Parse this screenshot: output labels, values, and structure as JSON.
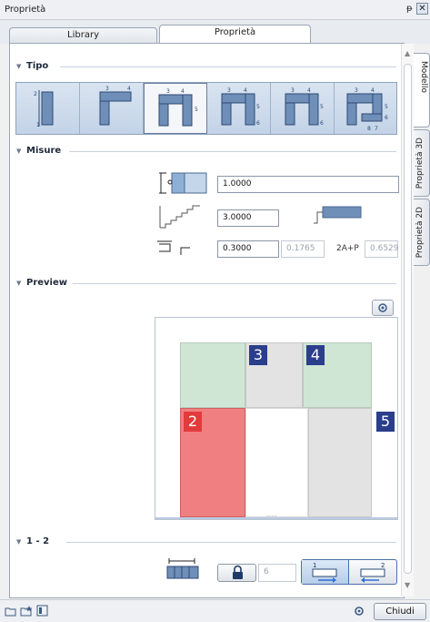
{
  "window": {
    "title": "Proprietà",
    "pin_glyph": "ᵽ",
    "close_glyph": "✕"
  },
  "tabs": [
    {
      "label": "Library"
    },
    {
      "label": "Proprietà"
    }
  ],
  "side_tabs": [
    {
      "label": "Modello"
    },
    {
      "label": "Proprietà 3D"
    },
    {
      "label": "Proprietà 2D"
    }
  ],
  "sections": {
    "tipo": {
      "label": "Tipo"
    },
    "misure": {
      "label": "Misure"
    },
    "preview": {
      "label": "Preview"
    },
    "range": {
      "label": "1 - 2"
    }
  },
  "type_options": [
    {
      "name": "type-1",
      "numbers": [
        "1",
        "2"
      ]
    },
    {
      "name": "type-1-4",
      "numbers": [
        "3",
        "4"
      ]
    },
    {
      "name": "type-1-5",
      "numbers": [
        "3",
        "4",
        "5"
      ],
      "selected": true
    },
    {
      "name": "type-1-6",
      "numbers": [
        "3",
        "4",
        "5",
        "6"
      ]
    },
    {
      "name": "type-1-7",
      "numbers": [
        "3",
        "4",
        "5",
        "6"
      ]
    },
    {
      "name": "type-1-8",
      "numbers": [
        "3",
        "4",
        "5",
        "6",
        "8",
        "7"
      ]
    }
  ],
  "misure": {
    "height": "1.0000",
    "steps": "3.0000",
    "tread": "0.3000",
    "riser": "0.1765",
    "formula_label": "2A+P",
    "formula_value": "0.6529"
  },
  "preview_badges": [
    "3",
    "4",
    "2",
    "5"
  ],
  "preview_scroll_label": "......",
  "range": {
    "count": "6"
  },
  "bottom": {
    "close_label": "Chiudi"
  },
  "colors": {
    "badge_blue": "#2b3e8c",
    "badge_red": "#e23b3b",
    "green": "#cfe6d4",
    "red_fill": "#ef7f80",
    "grey": "#e3e3e3",
    "accent": "#2d6fd6"
  }
}
